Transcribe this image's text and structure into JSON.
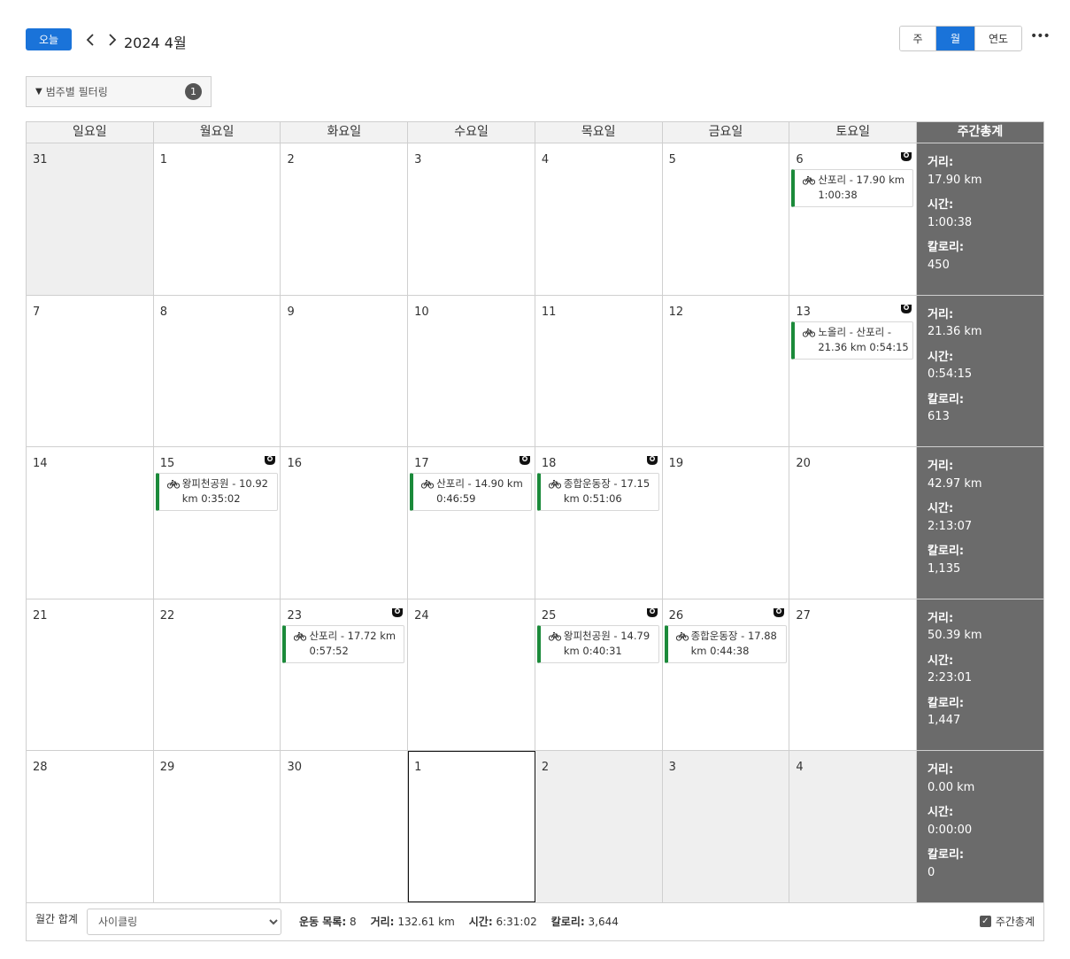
{
  "toolbar": {
    "today_label": "오늘",
    "prev_icon": "‹",
    "next_icon": "›",
    "title": "2024 4월",
    "views": [
      {
        "label": "주",
        "active": false
      },
      {
        "label": "월",
        "active": true
      },
      {
        "label": "연도",
        "active": false
      }
    ],
    "more_icon": "•••"
  },
  "filter": {
    "label": "범주별 필터링",
    "count": "1"
  },
  "colors": {
    "accent": "#1a73d9",
    "event_bar": "#1b8a3a",
    "totals_bg": "#6b6b6b"
  },
  "headers": [
    "일요일",
    "월요일",
    "화요일",
    "수요일",
    "목요일",
    "금요일",
    "토요일",
    "주간총계"
  ],
  "totals_labels": {
    "distance": "거리:",
    "time": "시간:",
    "calories": "칼로리:"
  },
  "weeks": [
    {
      "days": [
        {
          "num": "31",
          "other": true
        },
        {
          "num": "1"
        },
        {
          "num": "2"
        },
        {
          "num": "3"
        },
        {
          "num": "4"
        },
        {
          "num": "5"
        },
        {
          "num": "6",
          "trophy": true,
          "event": {
            "line1": "산포리 - 17.90 km",
            "line2": "1:00:38"
          }
        }
      ],
      "totals": {
        "distance": "17.90 km",
        "time": "1:00:38",
        "calories": "450"
      }
    },
    {
      "days": [
        {
          "num": "7"
        },
        {
          "num": "8"
        },
        {
          "num": "9"
        },
        {
          "num": "10"
        },
        {
          "num": "11"
        },
        {
          "num": "12"
        },
        {
          "num": "13",
          "trophy": true,
          "event": {
            "line1": "노올리 - 산포리 -",
            "line2": "21.36 km 0:54:15"
          }
        }
      ],
      "totals": {
        "distance": "21.36 km",
        "time": "0:54:15",
        "calories": "613"
      }
    },
    {
      "days": [
        {
          "num": "14"
        },
        {
          "num": "15",
          "trophy": true,
          "event": {
            "line1": "왕피천공원 - 10.92",
            "line2": "km 0:35:02"
          }
        },
        {
          "num": "16"
        },
        {
          "num": "17",
          "trophy": true,
          "event": {
            "line1": "산포리 - 14.90 km",
            "line2": "0:46:59"
          }
        },
        {
          "num": "18",
          "trophy": true,
          "event": {
            "line1": "종합운동장 - 17.15",
            "line2": "km 0:51:06"
          }
        },
        {
          "num": "19"
        },
        {
          "num": "20"
        }
      ],
      "totals": {
        "distance": "42.97 km",
        "time": "2:13:07",
        "calories": "1,135"
      }
    },
    {
      "days": [
        {
          "num": "21"
        },
        {
          "num": "22"
        },
        {
          "num": "23",
          "trophy": true,
          "event": {
            "line1": "산포리 - 17.72 km",
            "line2": "0:57:52"
          }
        },
        {
          "num": "24"
        },
        {
          "num": "25",
          "trophy": true,
          "event": {
            "line1": "왕피천공원 - 14.79",
            "line2": "km 0:40:31"
          }
        },
        {
          "num": "26",
          "trophy": true,
          "event": {
            "line1": "종합운동장 - 17.88",
            "line2": "km 0:44:38"
          }
        },
        {
          "num": "27"
        }
      ],
      "totals": {
        "distance": "50.39 km",
        "time": "2:23:01",
        "calories": "1,447"
      }
    },
    {
      "days": [
        {
          "num": "28"
        },
        {
          "num": "29"
        },
        {
          "num": "30"
        },
        {
          "num": "1",
          "today": true
        },
        {
          "num": "2",
          "other": true
        },
        {
          "num": "3",
          "other": true
        },
        {
          "num": "4",
          "other": true
        }
      ],
      "totals": {
        "distance": "0.00 km",
        "time": "0:00:00",
        "calories": "0"
      }
    }
  ],
  "footer": {
    "label": "월간 합계",
    "select_value": "사이클링",
    "stats": [
      {
        "label": "운동 목록:",
        "value": "8"
      },
      {
        "label": "거리:",
        "value": "132.61 km"
      },
      {
        "label": "시간:",
        "value": "6:31:02"
      },
      {
        "label": "칼로리:",
        "value": "3,644"
      }
    ],
    "checkbox_label": "주간총계",
    "checkbox_checked": true
  }
}
